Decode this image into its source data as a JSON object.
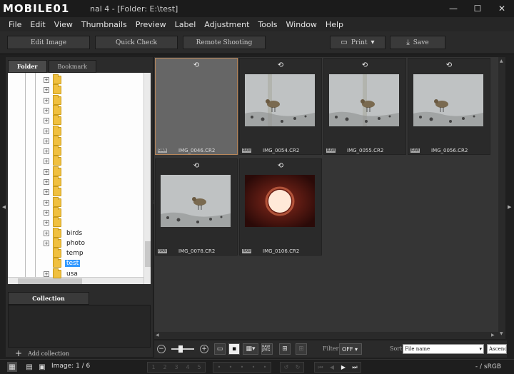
{
  "titlebar": {
    "logo": "MOBILE01",
    "title": "nal 4 - [Folder: E:\\test]",
    "minimize": "—",
    "maximize": "☐",
    "close": "✕"
  },
  "menu": [
    "File",
    "Edit",
    "View",
    "Thumbnails",
    "Preview",
    "Label",
    "Adjustment",
    "Tools",
    "Window",
    "Help"
  ],
  "toolbar": {
    "edit_image": "Edit Image",
    "quick_check": "Quick Check",
    "remote_shooting": "Remote Shooting",
    "print": "Print",
    "save": "Save"
  },
  "left_pane": {
    "tabs": [
      "Folder",
      "Bookmark"
    ],
    "folders": [
      {
        "name": "",
        "expander": "+"
      },
      {
        "name": "",
        "expander": "+"
      },
      {
        "name": "",
        "expander": "+"
      },
      {
        "name": "",
        "expander": "+"
      },
      {
        "name": "",
        "expander": "+"
      },
      {
        "name": "",
        "expander": "+"
      },
      {
        "name": "",
        "expander": "+"
      },
      {
        "name": "",
        "expander": "+"
      },
      {
        "name": "",
        "expander": "+"
      },
      {
        "name": "",
        "expander": "+"
      },
      {
        "name": "",
        "expander": "+"
      },
      {
        "name": "",
        "expander": "+"
      },
      {
        "name": "",
        "expander": "+"
      },
      {
        "name": "",
        "expander": "+"
      },
      {
        "name": "",
        "expander": "+"
      },
      {
        "name": "birds",
        "expander": "+"
      },
      {
        "name": "photo",
        "expander": "+"
      },
      {
        "name": "temp",
        "expander": ""
      },
      {
        "name": "test",
        "expander": "",
        "selected": true
      },
      {
        "name": "usa",
        "expander": "+"
      }
    ],
    "collection_tab": "Collection",
    "add_collection": "Add collection"
  },
  "thumbnails": [
    {
      "name": "IMG_0046.CR2",
      "badge": "RAW",
      "selected": true,
      "kind": "empty"
    },
    {
      "name": "IMG_0054.CR2",
      "badge": "RAW",
      "selected": false,
      "kind": "bird"
    },
    {
      "name": "IMG_0055.CR2",
      "badge": "RAW",
      "selected": false,
      "kind": "bird2"
    },
    {
      "name": "IMG_0056.CR2",
      "badge": "RAW",
      "selected": false,
      "kind": "bird3"
    },
    {
      "name": "IMG_0078.CR2",
      "badge": "RAW",
      "selected": false,
      "kind": "bird4"
    },
    {
      "name": "IMG_0106.CR2",
      "badge": "RAW",
      "selected": false,
      "kind": "sun"
    }
  ],
  "controls": {
    "filter_label": "Filter",
    "filter_value": "OFF",
    "sort_label": "Sort",
    "sort_value": "File name",
    "sort_dir": "Ascend",
    "raw_jpeg": "RAW JPEG"
  },
  "status": {
    "image_count": "Image: 1 / 6",
    "color_space": "- / sRGB"
  },
  "colors": {
    "accent_selected": "#b8865a",
    "folder_selected": "#3399ff",
    "folder_icon": "#f0c040"
  }
}
